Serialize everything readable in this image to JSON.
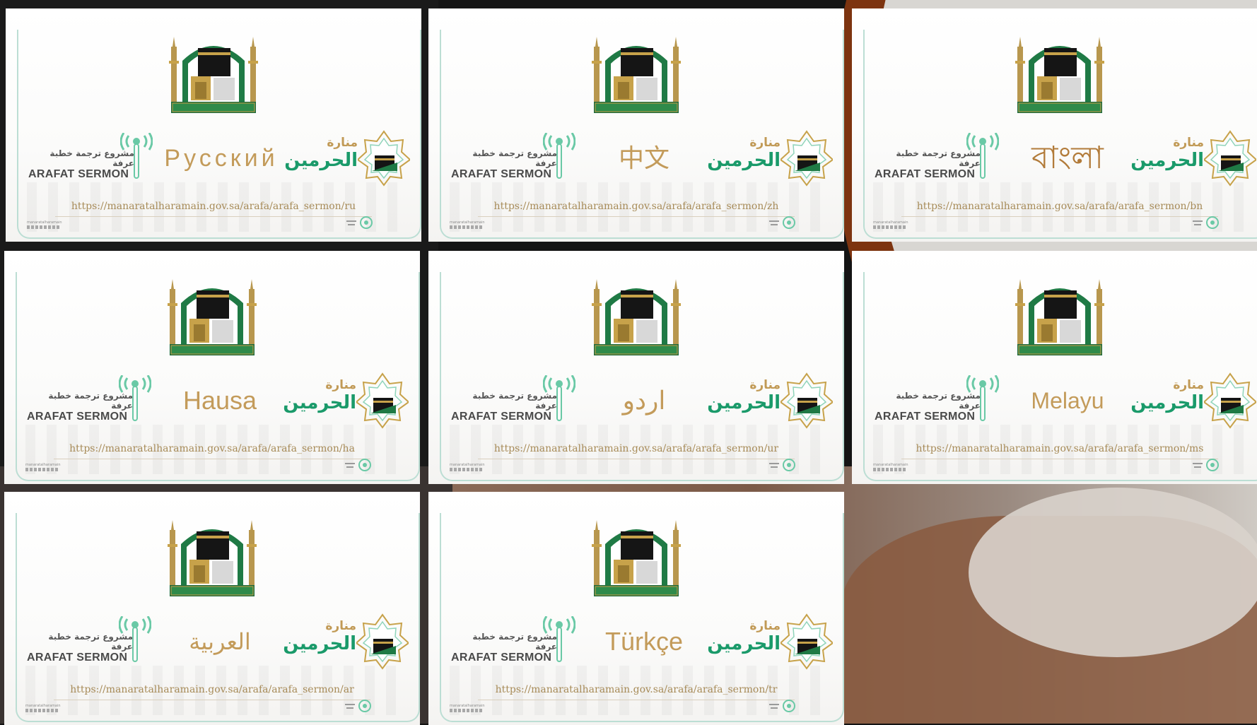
{
  "project_arabic": "مشروع ترجمة خطبة عرفة",
  "project_english": "ARAFAT SERMON",
  "brand_top": "منارة",
  "brand_main": "الحرمين",
  "footer_handle": "manaratalharamain",
  "icons": [
    "kaaba-emblem-icon",
    "antenna-mic-icon",
    "octagram-kaaba-icon",
    "social-icons",
    "broadcast-icon"
  ],
  "colors": {
    "gold": "#c39b5a",
    "green": "#1a9a6a",
    "frame": "#bcded4",
    "url": "#a78b58"
  },
  "cards": [
    {
      "language": "Русский",
      "url": "https://manaratalharamain.gov.sa/arafa/arafa_sermon/ru"
    },
    {
      "language": "中文",
      "url": "https://manaratalharamain.gov.sa/arafa/arafa_sermon/zh"
    },
    {
      "language": "বাংলা",
      "url": "https://manaratalharamain.gov.sa/arafa/arafa_sermon/bn"
    },
    {
      "language": "Hausa",
      "url": "https://manaratalharamain.gov.sa/arafa/arafa_sermon/ha"
    },
    {
      "language": "اردو",
      "url": "https://manaratalharamain.gov.sa/arafa/arafa_sermon/ur"
    },
    {
      "language": "Melayu",
      "url": "https://manaratalharamain.gov.sa/arafa/arafa_sermon/ms"
    },
    {
      "language": "العربية",
      "url": "https://manaratalharamain.gov.sa/arafa/arafa_sermon/ar"
    },
    {
      "language": "Türkçe",
      "url": "https://manaratalharamain.gov.sa/arafa/arafa_sermon/tr"
    }
  ]
}
